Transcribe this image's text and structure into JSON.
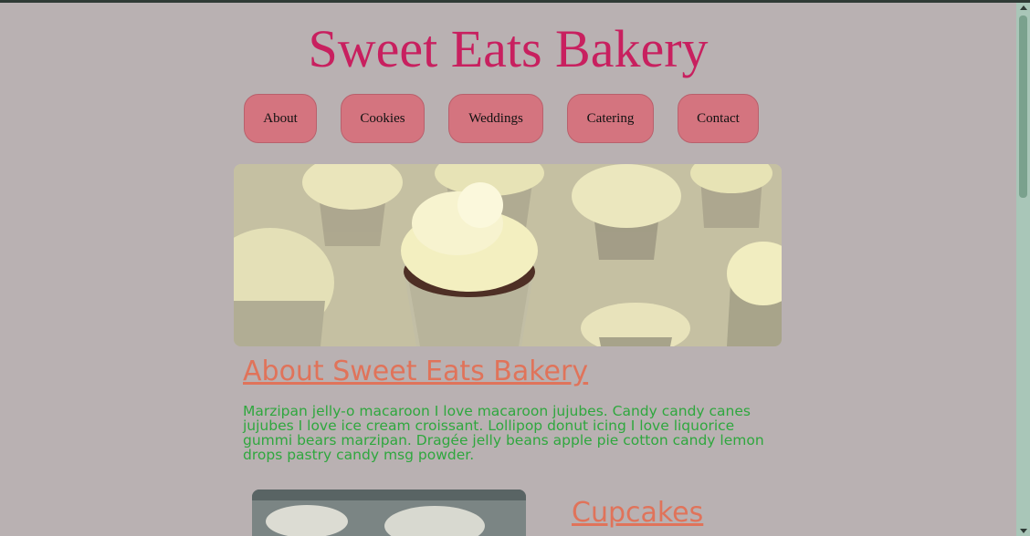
{
  "site": {
    "title": "Sweet Eats Bakery"
  },
  "nav": {
    "items": [
      {
        "label": "About"
      },
      {
        "label": "Cookies"
      },
      {
        "label": "Weddings"
      },
      {
        "label": "Catering"
      },
      {
        "label": "Contact"
      }
    ]
  },
  "about": {
    "title": "About Sweet Eats Bakery",
    "text": "Marzipan jelly-o macaroon I love macaroon jujubes. Candy candy canes jujubes I love ice cream croissant. Lollipop donut icing I love liquorice gummi bears marzipan. Dragée jelly beans apple pie cotton candy lemon drops pastry candy msg powder."
  },
  "sections": {
    "cupcakes_title": "Cupcakes"
  },
  "colors": {
    "title": "#c8205f",
    "nav_button": "#d4747f",
    "heading": "#e0735a",
    "body_text": "#2fa73e",
    "background": "#b9b1b2"
  }
}
